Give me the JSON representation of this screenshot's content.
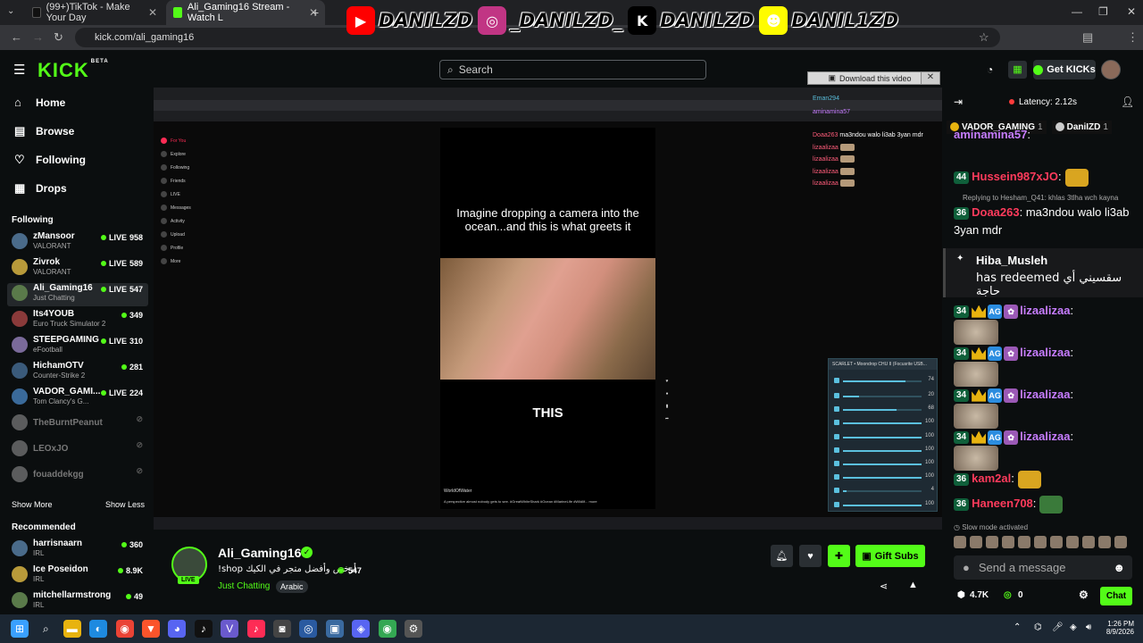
{
  "browser": {
    "tabs": [
      {
        "label": "(99+)TikTok - Make Your Day",
        "color": "#111111"
      },
      {
        "label": "Ali_Gaming16 Stream - Watch L",
        "color": "#53fc18"
      }
    ],
    "url": "kick.com/ali_gaming16"
  },
  "overlay_banner": [
    {
      "icon": "youtube-icon",
      "handle": "DANILZD",
      "color": "#ff0000",
      "glyph": "▶"
    },
    {
      "icon": "instagram-icon",
      "handle": "_DANILZD_",
      "color": "#c13584",
      "glyph": "◎"
    },
    {
      "icon": "kick-icon",
      "handle": "DANILZD",
      "color": "#000000",
      "glyph": "K"
    },
    {
      "icon": "snapchat-icon",
      "handle": "DANIL1ZD",
      "color": "#fffc00",
      "glyph": "☻"
    }
  ],
  "header": {
    "logo": "KICK",
    "logo_sup": "BETA",
    "search_placeholder": "Search",
    "get_kicks": "Get KICKs"
  },
  "sidebar": {
    "nav": [
      {
        "label": "Home",
        "icon": "home-icon"
      },
      {
        "label": "Browse",
        "icon": "browse-icon"
      },
      {
        "label": "Following",
        "icon": "heart-icon"
      },
      {
        "label": "Drops",
        "icon": "drops-icon"
      }
    ],
    "following_title": "Following",
    "following": [
      {
        "name": "zMansoor",
        "game": "VALORANT",
        "viewers": "958",
        "live": true
      },
      {
        "name": "Zivrok",
        "game": "VALORANT",
        "viewers": "589",
        "live": true
      },
      {
        "name": "Ali_Gaming16",
        "game": "Just Chatting",
        "viewers": "547",
        "live": true
      },
      {
        "name": "Its4YOUB",
        "game": "Euro Truck Simulator 2",
        "viewers": "349",
        "live": false
      },
      {
        "name": "STEEPGAMING",
        "game": "eFootball",
        "viewers": "310",
        "live": true
      },
      {
        "name": "HichamOTV",
        "game": "Counter-Strike 2",
        "viewers": "281",
        "live": false
      },
      {
        "name": "VADOR_GAMI...",
        "game": "Tom Clancy's G...",
        "viewers": "224",
        "live": true
      },
      {
        "name": "TheBurntPeanut",
        "game": "",
        "viewers": "",
        "live": false
      },
      {
        "name": "LEOxJO",
        "game": "",
        "viewers": "",
        "live": false
      },
      {
        "name": "fouaddekgg",
        "game": "",
        "viewers": "",
        "live": false
      }
    ],
    "show_more": "Show More",
    "show_less": "Show Less",
    "recommended_title": "Recommended",
    "recommended": [
      {
        "name": "harrisnaarn",
        "game": "IRL",
        "viewers": "360"
      },
      {
        "name": "Ice Poseidon",
        "game": "IRL",
        "viewers": "8.9K"
      },
      {
        "name": "mitchellarmstrong",
        "game": "IRL",
        "viewers": "49"
      }
    ]
  },
  "stream_content": {
    "video_caption": "Imagine dropping a camera into the ocean...and this is what greets it",
    "video_word": "THIS",
    "video_author": "WorldOfWater",
    "video_desc": "A perspective almost nobody gets to see. #GreatWhiteShark #Ocean #MarineLife #Wildlif... more",
    "download_label": "Download this video",
    "tt_nav": [
      "For You",
      "Explore",
      "Following",
      "Friends",
      "LIVE",
      "Messages",
      "Activity",
      "Upload",
      "Profile",
      "More"
    ],
    "overlay_chat": [
      {
        "user": "Eman294",
        "text": ""
      },
      {
        "user": "aminamina57",
        "text": ""
      },
      {
        "user": "Doaa263",
        "text": "ma3ndou walo li3ab 3yan mdr"
      },
      {
        "user": "lizaalizaa",
        "text": ""
      },
      {
        "user": "lizaalizaa",
        "text": ""
      },
      {
        "user": "lizaalizaa",
        "text": ""
      },
      {
        "user": "lizaalizaa",
        "text": ""
      }
    ],
    "mixer_title": "SCARLET • Moondrop CHU II (Focusrite USB...",
    "mixer_master": "74",
    "mixer_rows": [
      {
        "value": "20",
        "level": 0.2
      },
      {
        "value": "68",
        "level": 0.68
      },
      {
        "value": "100",
        "level": 1
      },
      {
        "value": "100",
        "level": 1
      },
      {
        "value": "100",
        "level": 1
      },
      {
        "value": "100",
        "level": 1
      },
      {
        "value": "100",
        "level": 1
      },
      {
        "value": "4",
        "level": 0.04
      },
      {
        "value": "100",
        "level": 1
      }
    ]
  },
  "stream_info": {
    "streamer": "Ali_Gaming16",
    "title": "!shop أرخص وأفضل متجر في الكيك",
    "viewers": "547",
    "category": "Just Chatting",
    "tag": "Arabic",
    "live_badge": "LIVE",
    "gift_subs": "Gift Subs"
  },
  "chat": {
    "latency": "Latency: 2.12s",
    "pinned": [
      {
        "name": "VADOR_GAMING",
        "count": "1",
        "color": "#e8b30f"
      },
      {
        "name": "DaniIZD",
        "count": "1",
        "color": "#cccccc"
      }
    ],
    "messages": [
      {
        "badge": "",
        "user": "aminamina57",
        "text": ":",
        "color": "#c77dff"
      },
      {
        "badge": "44",
        "user": "Hussein987xJO",
        "text": ":",
        "color": "#ff3b5c"
      },
      {
        "badge": "36",
        "user": "Doaa263",
        "text": ": ma3ndou walo li3ab 3yan mdr",
        "color": "#ff3b5c"
      },
      {
        "badge": "34",
        "user": "lizaalizaa",
        "text": ":",
        "color": "#c77dff"
      },
      {
        "badge": "34",
        "user": "lizaalizaa",
        "text": ":",
        "color": "#c77dff"
      },
      {
        "badge": "34",
        "user": "lizaalizaa",
        "text": ":",
        "color": "#c77dff"
      },
      {
        "badge": "34",
        "user": "lizaalizaa",
        "text": ":",
        "color": "#c77dff"
      },
      {
        "badge": "36",
        "user": "kam2al",
        "text": ":",
        "color": "#ff3b5c"
      },
      {
        "badge": "36",
        "user": "Haneen708",
        "text": ":",
        "color": "#ff3b5c"
      }
    ],
    "reply_to": "Replying to Hesham_Q41: khlas 3tlha wch kayna",
    "redeem_user": "Hiba_Musleh",
    "redeem_text": "has redeemed سقسيني أي حاجة",
    "slow_mode": "Slow mode activated",
    "send_placeholder": "Send a message",
    "kicks_count": "4.7K",
    "points": "0",
    "chat_button": "Chat"
  },
  "taskbar": {
    "time": "1:26 PM",
    "date": "8/9/2026"
  }
}
